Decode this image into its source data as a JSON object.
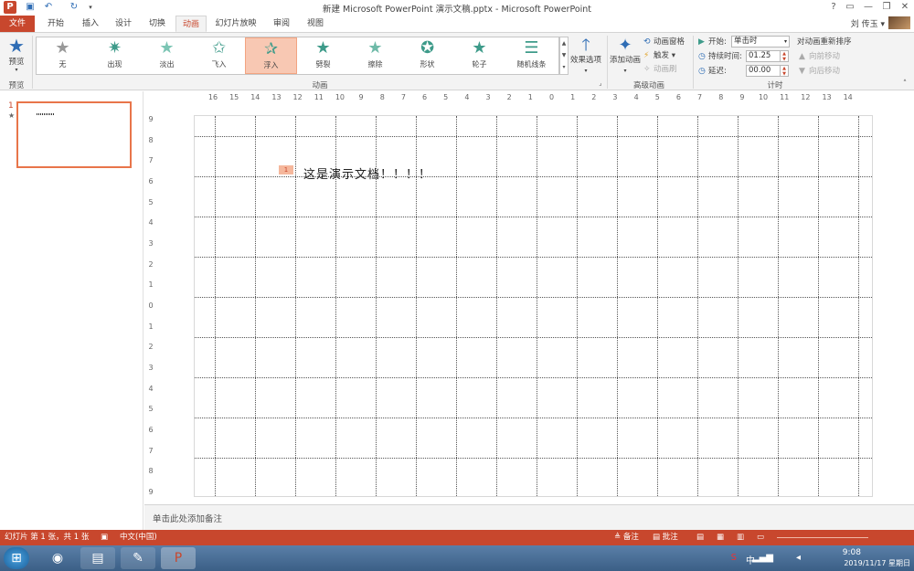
{
  "window": {
    "title": "新建 Microsoft PowerPoint 演示文稿.pptx - Microsoft PowerPoint",
    "app_icon": "P",
    "quick_access": [
      "save-icon",
      "undo-icon",
      "redo-icon",
      "customize-icon"
    ],
    "buttons": [
      "?",
      "▭",
      "—",
      "❐",
      "✕"
    ]
  },
  "tabs": [
    {
      "label": "文件"
    },
    {
      "label": "开始"
    },
    {
      "label": "插入"
    },
    {
      "label": "设计"
    },
    {
      "label": "切换"
    },
    {
      "label": "动画"
    },
    {
      "label": "幻灯片放映"
    },
    {
      "label": "审阅"
    },
    {
      "label": "视图"
    }
  ],
  "active_tab": "动画",
  "user": {
    "name": "刘 传玉 ▾"
  },
  "ribbon": {
    "preview": {
      "label": "预览",
      "group": "预览"
    },
    "animations": {
      "group": "动画",
      "items": [
        {
          "label": "无"
        },
        {
          "label": "出现"
        },
        {
          "label": "淡出"
        },
        {
          "label": "飞入"
        },
        {
          "label": "浮入"
        },
        {
          "label": "劈裂"
        },
        {
          "label": "擦除"
        },
        {
          "label": "形状"
        },
        {
          "label": "轮子"
        },
        {
          "label": "随机线条"
        }
      ],
      "selected": "浮入",
      "effect_options": "效果选项"
    },
    "advanced": {
      "group": "高级动画",
      "add_animation": "添加动画",
      "pane": "动画窗格",
      "trigger": "触发 ▾",
      "painter": "动画刷"
    },
    "timing": {
      "group": "计时",
      "start_label": "开始:",
      "start_value": "单击时",
      "duration_label": "持续时间:",
      "duration_value": "01.25",
      "delay_label": "延迟:",
      "delay_value": "00.00",
      "reorder_title": "对动画重新排序",
      "move_earlier": "向前移动",
      "move_later": "向后移动"
    }
  },
  "ruler_h": [
    "16",
    "15",
    "14",
    "13",
    "12",
    "11",
    "10",
    "9",
    "8",
    "7",
    "6",
    "5",
    "4",
    "3",
    "2",
    "1",
    "0",
    "1",
    "2",
    "3",
    "4",
    "5",
    "6",
    "7",
    "8",
    "9",
    "10",
    "11",
    "12",
    "13",
    "14",
    "15",
    "16"
  ],
  "ruler_v": [
    "9",
    "8",
    "7",
    "6",
    "5",
    "4",
    "3",
    "2",
    "1",
    "0",
    "1",
    "2",
    "3",
    "4",
    "5",
    "6",
    "7",
    "8",
    "9"
  ],
  "thumbnail": {
    "number": "1",
    "star": "★"
  },
  "slide": {
    "anim_tag": "1",
    "text": "这是演示文档！！！！"
  },
  "notes": {
    "placeholder": "单击此处添加备注"
  },
  "statusbar": {
    "slide_info": "幻灯片 第 1 张，共 1 张",
    "language": "中文(中国)",
    "notes_btn": "备注",
    "comments_btn": "批注"
  },
  "clock": {
    "time": "9:08",
    "date": "2019/11/17 星期日"
  }
}
